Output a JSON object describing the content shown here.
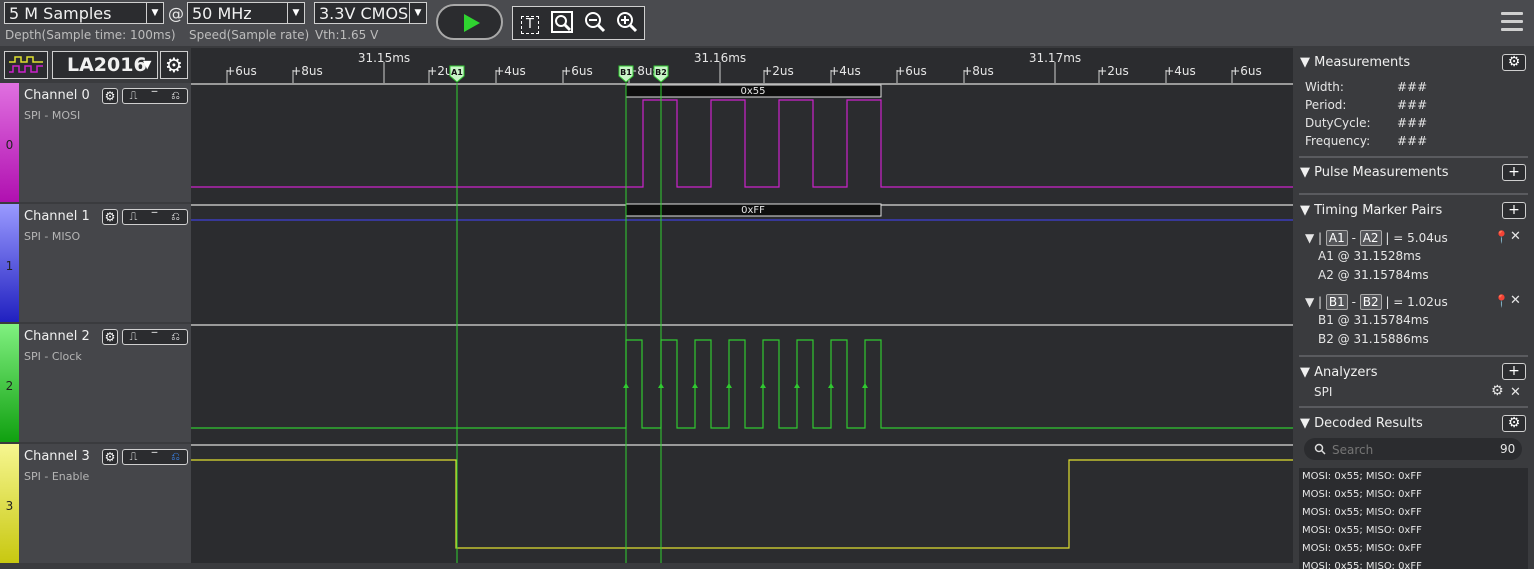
{
  "toolbar": {
    "depth": "5 M Samples",
    "depth_sub": "Depth(Sample time: 100ms)",
    "at": "@",
    "speed": "50 MHz",
    "speed_sub": "Speed(Sample rate)",
    "voltage": "3.3V CMOS",
    "voltage_sub": "Vth:1.65 V",
    "dropdown_arrow": "▼",
    "text_tool": "T",
    "zoom_fit_icon": "zoom-fit-icon",
    "zoom_out_icon": "zoom-out-icon",
    "zoom_in_icon": "zoom-in-icon",
    "run_icon": "play-icon"
  },
  "device": {
    "name": "LA2016",
    "arrow": "▼"
  },
  "timeline": {
    "ticks": [
      "+6us",
      "+8us",
      "31.15ms",
      "+2us",
      "+4us",
      "+6us",
      "+8us",
      "31.16ms",
      "+2us",
      "+4us",
      "+6us",
      "+8us",
      "31.17ms",
      "+2us",
      "+4us",
      "+6us"
    ],
    "markers": [
      "A1",
      "B1",
      "B2"
    ]
  },
  "channels": [
    {
      "name": "Channel 0",
      "sub": "SPI - MOSI",
      "num": "0",
      "color": "#cc22cc",
      "decode": "0x55"
    },
    {
      "name": "Channel 1",
      "sub": "SPI - MISO",
      "num": "1",
      "color": "#3f3fd8",
      "decode": "0xFF"
    },
    {
      "name": "Channel 2",
      "sub": "SPI - Clock",
      "num": "2",
      "color": "#30c830"
    },
    {
      "name": "Channel 3",
      "sub": "SPI - Enable",
      "num": "3",
      "color": "#e0e030"
    }
  ],
  "panel": {
    "measurements": {
      "title": "Measurements",
      "rows": [
        {
          "k": "Width:",
          "v": "###"
        },
        {
          "k": "Period:",
          "v": "###"
        },
        {
          "k": "DutyCycle:",
          "v": "###"
        },
        {
          "k": "Frequency:",
          "v": "###"
        }
      ]
    },
    "pulse": {
      "title": "Pulse Measurements"
    },
    "timing": {
      "title": "Timing Marker Pairs",
      "pairs": [
        {
          "a": "A1",
          "b": "A2",
          "value": "| = 5.04us",
          "l1": "A1 @ 31.1528ms",
          "l2": "A2 @ 31.15784ms"
        },
        {
          "a": "B1",
          "b": "B2",
          "value": "| = 1.02us",
          "l1": "B1 @ 31.15784ms",
          "l2": "B2 @ 31.15886ms"
        }
      ]
    },
    "analyzers": {
      "title": "Analyzers",
      "item": "SPI"
    },
    "decoded": {
      "title": "Decoded Results",
      "search_placeholder": "Search",
      "count": "90",
      "results": [
        "MOSI: 0x55;  MISO: 0xFF",
        "MOSI: 0x55;  MISO: 0xFF",
        "MOSI: 0x55;  MISO: 0xFF",
        "MOSI: 0x55;  MISO: 0xFF",
        "MOSI: 0x55;  MISO: 0xFF",
        "MOSI: 0x55;  MISO: 0xFF"
      ]
    }
  }
}
